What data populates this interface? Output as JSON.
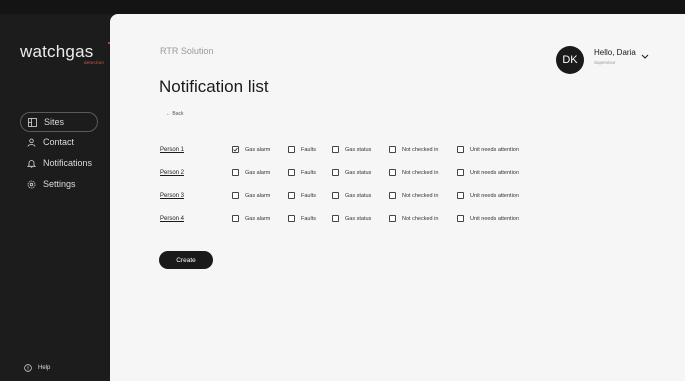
{
  "brand": {
    "logo_text": "watchgas",
    "logo_sub": "detection"
  },
  "sidebar": {
    "items": [
      {
        "label": "Sites",
        "icon": "building-icon",
        "active": true
      },
      {
        "label": "Contact",
        "icon": "person-icon",
        "active": false
      },
      {
        "label": "Notifications",
        "icon": "bell-icon",
        "active": false
      },
      {
        "label": "Settings",
        "icon": "gear-icon",
        "active": false
      }
    ],
    "help_label": "Help"
  },
  "header": {
    "breadcrumb": "RTR Solution",
    "title": "Notification list",
    "back_label": "Back"
  },
  "user": {
    "initials": "DK",
    "greeting": "Hello, Daria",
    "role": "Supervisor"
  },
  "options": [
    "Gas alarm",
    "Faults",
    "Gas status",
    "Not checked in",
    "Unit needs attention"
  ],
  "rows": [
    {
      "person": "Person 1",
      "checked": [
        true,
        false,
        false,
        false,
        false
      ]
    },
    {
      "person": "Person 2",
      "checked": [
        false,
        false,
        false,
        false,
        false
      ]
    },
    {
      "person": "Person 3",
      "checked": [
        false,
        false,
        false,
        false,
        false
      ]
    },
    {
      "person": "Person 4",
      "checked": [
        false,
        false,
        false,
        false,
        false
      ]
    }
  ],
  "create_label": "Create",
  "colors": {
    "sidebar": "#1c1c1c",
    "main_bg": "#f6f6f6",
    "accent": "#e0553a"
  }
}
